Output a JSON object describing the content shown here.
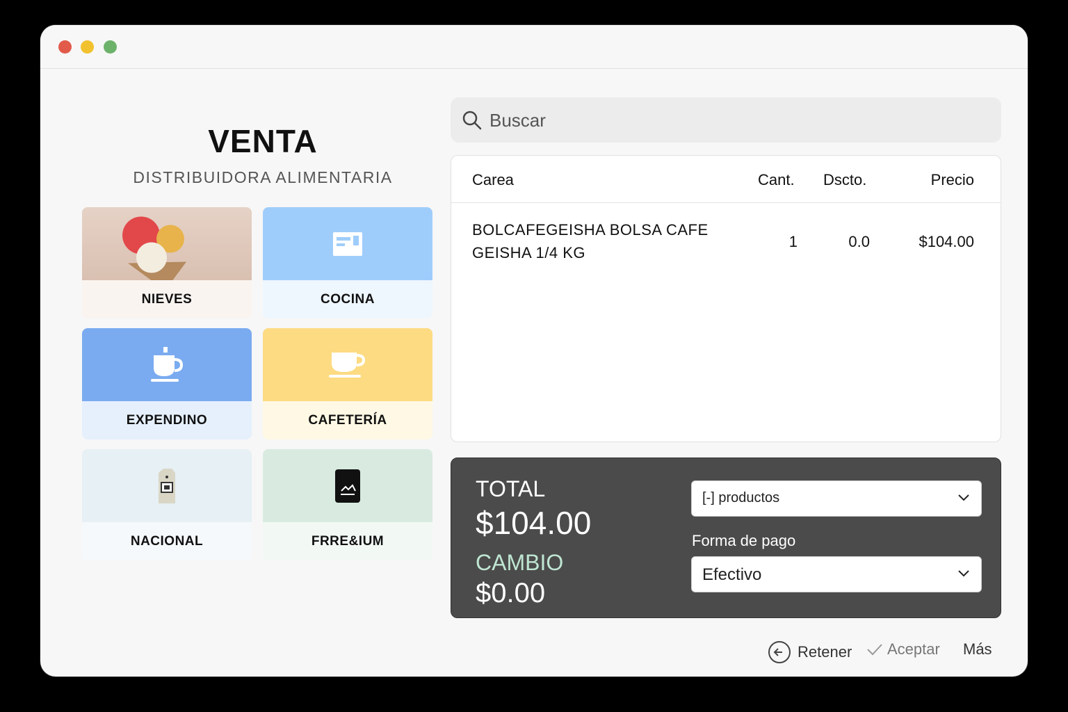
{
  "header": {
    "title": "VENTA",
    "subtitle": "DISTRIBUIDORA ALIMENTARIA"
  },
  "categories": [
    {
      "label": "NIEVES",
      "icon": "ice-cream-icon"
    },
    {
      "label": "COCINA",
      "icon": "kitchen-icon"
    },
    {
      "label": "EXPENDINO",
      "icon": "coffee-cup-icon"
    },
    {
      "label": "CAFETERÍA",
      "icon": "coffee-cup-icon"
    },
    {
      "label": "NACIONAL",
      "icon": "coffee-bag-icon"
    },
    {
      "label": "FRRE&IUM",
      "icon": "premium-package-icon"
    }
  ],
  "search": {
    "placeholder": "Buscar"
  },
  "table": {
    "headers": [
      "Carea",
      "Cant.",
      "Dscto.",
      "Precio"
    ],
    "rows": [
      {
        "name_line1": "BOLCAFEGEISHA BOLSA CAFE",
        "name_line2": "GEISHA 1/4 KG",
        "qty": "1",
        "discount": "0.0",
        "price": "$104.00"
      }
    ]
  },
  "totals": {
    "total_label": "TOTAL",
    "total_value": "$104.00",
    "change_label": "CAMBIO",
    "change_value": "$0.00",
    "products_select": "[-] productos",
    "payment_label": "Forma de pago",
    "payment_select": "Efectivo"
  },
  "footer": {
    "hold": "Retener",
    "accept": "Aceptar",
    "more": "Más"
  },
  "colors": {
    "cocina": "#9fcdfb",
    "expendino": "#7aabf0",
    "cafeteria": "#fddb82",
    "nacional": "#e6f0f5",
    "premium": "#d9ebe0",
    "totals_bg": "#4b4b4b",
    "cambio": "#bfe6d3"
  }
}
